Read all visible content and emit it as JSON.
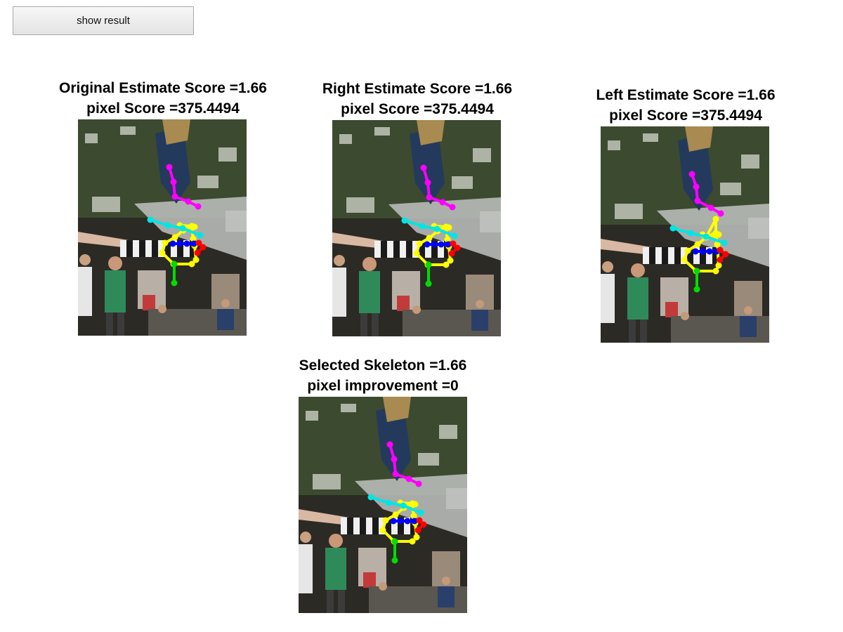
{
  "toolbar": {
    "show_result_label": "show result"
  },
  "panels": {
    "original": {
      "line1": "Original Estimate Score =1.66",
      "line2": "pixel Score =375.4494"
    },
    "right": {
      "line1": "Right Estimate Score =1.66",
      "line2": "pixel Score =375.4494"
    },
    "left": {
      "line1": "Left Estimate Score =1.66",
      "line2": "pixel Score =375.4494"
    },
    "selected": {
      "line1": "Selected Skeleton =1.66",
      "line2": "pixel improvement =0"
    }
  },
  "skeleton_colors": {
    "legs": "#ff00ff",
    "arm": "#00e5e5",
    "torso": "#ffff00",
    "head": "#0000ff",
    "hand": "#ff0000",
    "neck": "#00dd00"
  }
}
